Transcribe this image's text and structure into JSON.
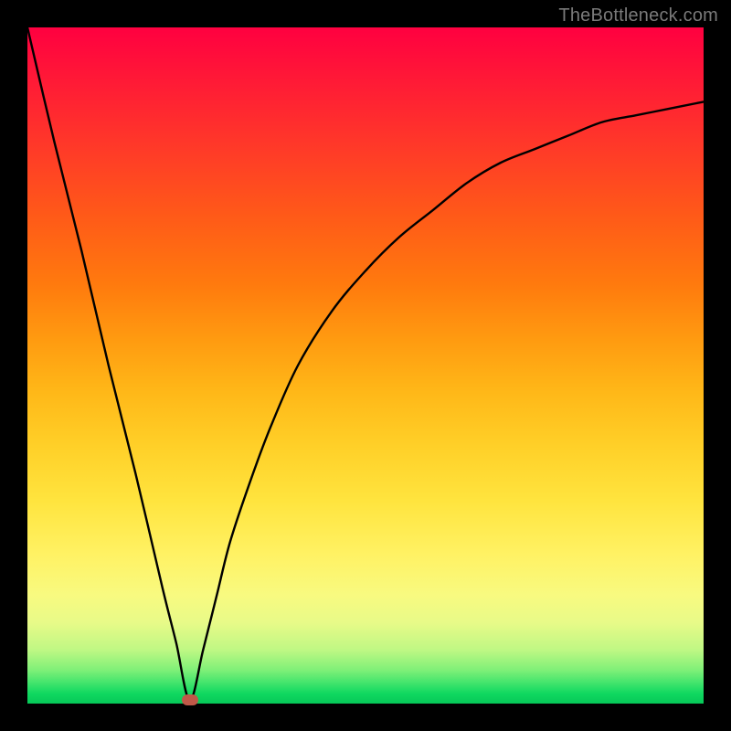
{
  "attribution": "TheBottleneck.com",
  "colors": {
    "frame": "#000000",
    "gradient_top": "#ff0040",
    "gradient_bottom": "#06c858",
    "curve": "#000000",
    "dot": "#c05848"
  },
  "chart_data": {
    "type": "line",
    "title": "",
    "xlabel": "",
    "ylabel": "",
    "xlim": [
      0,
      100
    ],
    "ylim": [
      0,
      100
    ],
    "grid": false,
    "legend": false,
    "annotations": [
      {
        "type": "dot",
        "x": 24,
        "y": 0.5
      }
    ],
    "series": [
      {
        "name": "curve",
        "x": [
          0,
          4,
          8,
          12,
          16,
          20,
          22,
          24,
          26,
          28,
          30,
          33,
          36,
          40,
          45,
          50,
          55,
          60,
          65,
          70,
          75,
          80,
          85,
          90,
          95,
          100
        ],
        "values": [
          100,
          83,
          67,
          50,
          34,
          17,
          9,
          0.5,
          8,
          16,
          24,
          33,
          41,
          50,
          58,
          64,
          69,
          73,
          77,
          80,
          82,
          84,
          86,
          87,
          88,
          89
        ]
      }
    ]
  }
}
